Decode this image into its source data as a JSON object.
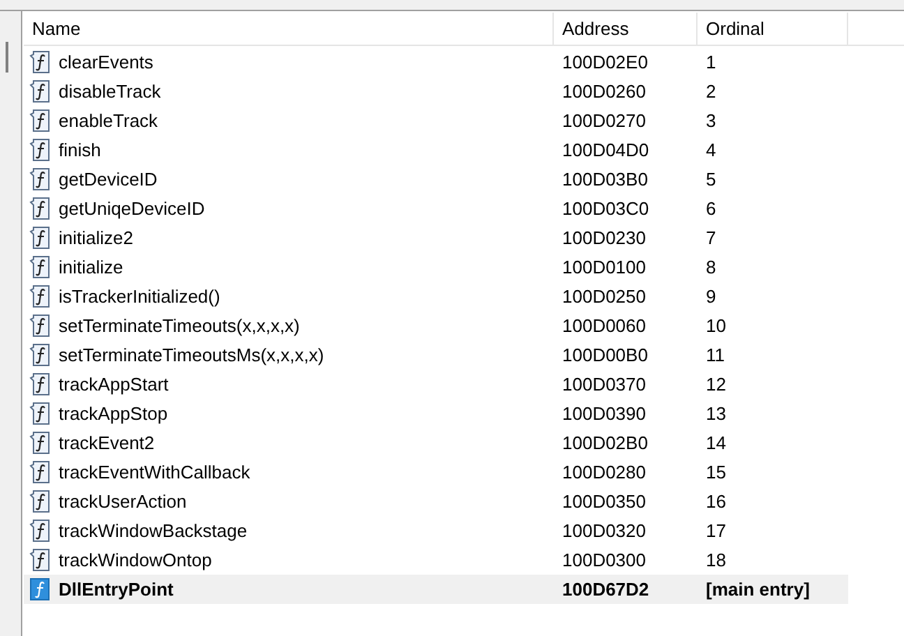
{
  "table": {
    "columns": [
      "Name",
      "Address",
      "Ordinal"
    ],
    "rows": [
      {
        "kind": "function",
        "name": "clearEvents",
        "address": "100D02E0",
        "ordinal": "1"
      },
      {
        "kind": "function",
        "name": "disableTrack",
        "address": "100D0260",
        "ordinal": "2"
      },
      {
        "kind": "function",
        "name": "enableTrack",
        "address": "100D0270",
        "ordinal": "3"
      },
      {
        "kind": "function",
        "name": "finish",
        "address": "100D04D0",
        "ordinal": "4"
      },
      {
        "kind": "function",
        "name": "getDeviceID",
        "address": "100D03B0",
        "ordinal": "5"
      },
      {
        "kind": "function",
        "name": "getUniqeDeviceID",
        "address": "100D03C0",
        "ordinal": "6"
      },
      {
        "kind": "function",
        "name": "initialize2",
        "address": "100D0230",
        "ordinal": "7"
      },
      {
        "kind": "function",
        "name": "initialize",
        "address": "100D0100",
        "ordinal": "8"
      },
      {
        "kind": "function",
        "name": "isTrackerInitialized()",
        "address": "100D0250",
        "ordinal": "9"
      },
      {
        "kind": "function",
        "name": "setTerminateTimeouts(x,x,x,x)",
        "address": "100D0060",
        "ordinal": "10"
      },
      {
        "kind": "function",
        "name": "setTerminateTimeoutsMs(x,x,x,x)",
        "address": "100D00B0",
        "ordinal": "11"
      },
      {
        "kind": "function",
        "name": "trackAppStart",
        "address": "100D0370",
        "ordinal": "12"
      },
      {
        "kind": "function",
        "name": "trackAppStop",
        "address": "100D0390",
        "ordinal": "13"
      },
      {
        "kind": "function",
        "name": "trackEvent2",
        "address": "100D02B0",
        "ordinal": "14"
      },
      {
        "kind": "function",
        "name": "trackEventWithCallback",
        "address": "100D0280",
        "ordinal": "15"
      },
      {
        "kind": "function",
        "name": "trackUserAction",
        "address": "100D0350",
        "ordinal": "16"
      },
      {
        "kind": "function",
        "name": "trackWindowBackstage",
        "address": "100D0320",
        "ordinal": "17"
      },
      {
        "kind": "function",
        "name": "trackWindowOntop",
        "address": "100D0300",
        "ordinal": "18"
      },
      {
        "kind": "entry",
        "name": "DllEntryPoint",
        "address": "100D67D2",
        "ordinal": "[main entry]"
      }
    ]
  }
}
